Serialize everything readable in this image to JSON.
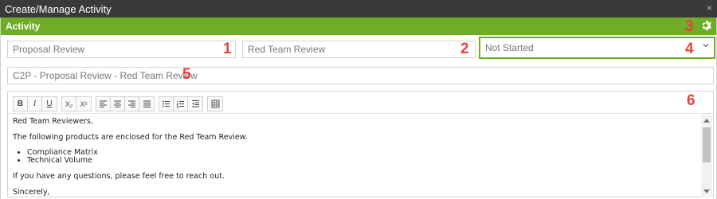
{
  "window": {
    "title": "Create/Manage Activity",
    "close_glyph": "×"
  },
  "header": {
    "title": "Activity",
    "settings_icon": "gear-icon"
  },
  "fields": {
    "name": "Proposal Review",
    "team": "Red Team Review",
    "status": "Not Started",
    "subject": "C2P - Proposal Review - Red Team Review"
  },
  "callouts": [
    "1",
    "2",
    "3",
    "4",
    "5",
    "6"
  ],
  "toolbar": {
    "bold": "B",
    "italic": "I",
    "underline": "U",
    "subscript": "X₂",
    "superscript": "X²"
  },
  "editor": {
    "greeting": "Red Team Reviewers,",
    "intro": "The following products are enclosed for the Red Team Review.",
    "items": [
      "Compliance Matrix",
      "Technical Volume"
    ],
    "closing": "If you have any questions, please feel free to reach out.",
    "signoff": "Sincerely,"
  },
  "colors": {
    "accent": "#70ad26",
    "callout": "#e8413e",
    "titlebar": "#3a3a3a"
  }
}
